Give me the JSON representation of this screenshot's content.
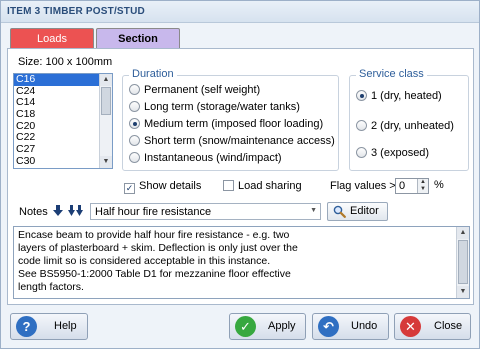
{
  "window": {
    "title": "ITEM 3 TIMBER POST/STUD"
  },
  "tabs": [
    {
      "label": "Loads",
      "color": "#ec5252"
    },
    {
      "label": "Section",
      "color": "#c8b8ec"
    }
  ],
  "size_label": "Size: 100 x 100mm",
  "grades": {
    "items": [
      "C16",
      "C24",
      "C14",
      "C18",
      "C20",
      "C22",
      "C27",
      "C30"
    ],
    "selected": "C16"
  },
  "duration": {
    "label": "Duration",
    "options": [
      {
        "label": "Permanent (self weight)",
        "checked": false
      },
      {
        "label": "Long term (storage/water tanks)",
        "checked": false
      },
      {
        "label": "Medium term (imposed floor loading)",
        "checked": true
      },
      {
        "label": "Short term (snow/maintenance access)",
        "checked": false
      },
      {
        "label": "Instantaneous (wind/impact)",
        "checked": false
      }
    ]
  },
  "service_class": {
    "label": "Service class",
    "options": [
      {
        "label": "1 (dry, heated)",
        "checked": true
      },
      {
        "label": "2 (dry, unheated)",
        "checked": false
      },
      {
        "label": "3 (exposed)",
        "checked": false
      }
    ]
  },
  "options": {
    "show_details": {
      "label": "Show details",
      "checked": true
    },
    "load_sharing": {
      "label": "Load sharing",
      "checked": false
    },
    "flag_values": {
      "label": "Flag values >",
      "value": "0",
      "unit": "%"
    }
  },
  "notes": {
    "label": "Notes",
    "selected": "Half hour fire resistance",
    "editor_label": "Editor",
    "lines": [
      "Encase beam to provide half hour fire  resistance  - e.g. two",
      "layers of plasterboard +  skim. Deflection is only just over the",
      "code limit so is  considered acceptable in this instance.",
      "See BS5950-1:2000 Table D1 for mezzanine floor effective",
      "length factors."
    ]
  },
  "footer": {
    "help": "Help",
    "apply": "Apply",
    "undo": "Undo",
    "close": "Close"
  }
}
